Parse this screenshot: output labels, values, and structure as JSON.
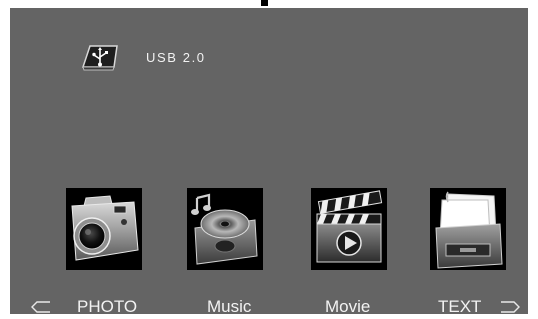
{
  "device": {
    "label": "USB 2.0",
    "icon": "usb-drive-icon"
  },
  "menu": {
    "items": [
      {
        "label": "PHOTO",
        "icon": "camera-icon",
        "selected": true
      },
      {
        "label": "Music",
        "icon": "music-player-icon",
        "selected": false
      },
      {
        "label": "Movie",
        "icon": "clapperboard-icon",
        "selected": false
      },
      {
        "label": "TEXT",
        "icon": "file-cabinet-icon",
        "selected": false
      }
    ]
  },
  "nav": {
    "left_icon": "nav-left-arrow-icon",
    "right_icon": "nav-right-arrow-icon"
  },
  "colors": {
    "background": "#646464",
    "text": "#f2f2f2"
  }
}
